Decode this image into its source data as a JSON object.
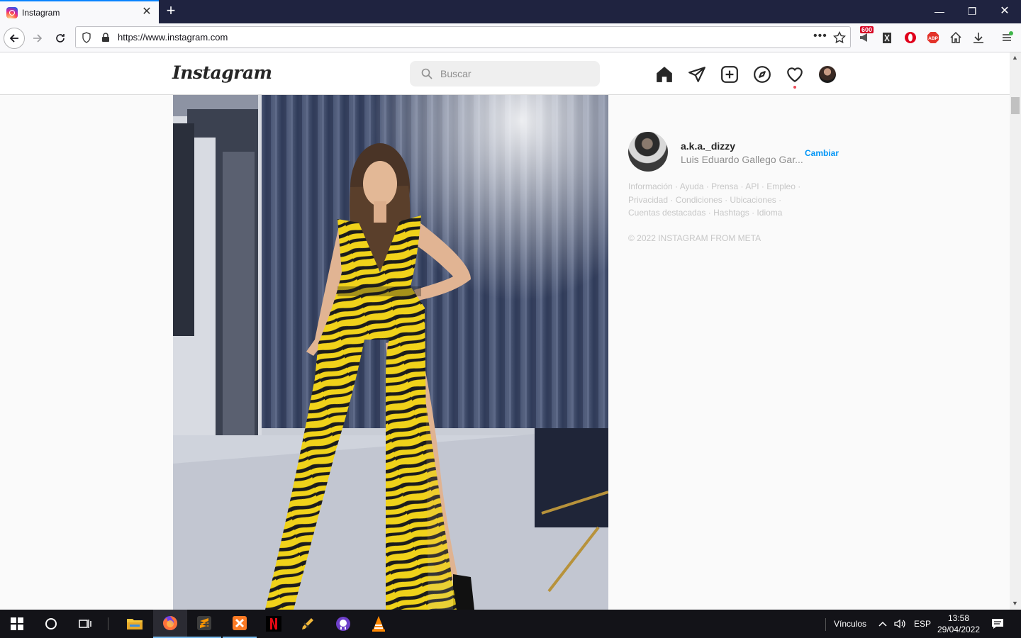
{
  "browser": {
    "tab_title": "Instagram",
    "url": "https://www.instagram.com",
    "badge_count": "600"
  },
  "instagram": {
    "logo": "Instagram",
    "search_placeholder": "Buscar",
    "nav_icons": [
      "home-icon",
      "direct-icon",
      "new-post-icon",
      "explore-icon",
      "activity-icon",
      "profile-avatar"
    ],
    "suggested": {
      "username": "a.k.a._dizzy",
      "fullname": "Luis Eduardo Gallego Gar...",
      "switch_label": "Cambiar"
    },
    "footer_lines": [
      "Información · Ayuda · Prensa · API · Empleo ·",
      "Privacidad · Condiciones · Ubicaciones ·",
      "Cuentas destacadas · Hashtags · Idioma"
    ],
    "copyright": "© 2022 INSTAGRAM FROM META"
  },
  "taskbar": {
    "links_label": "Vínculos",
    "language": "ESP",
    "time": "13:58",
    "date": "29/04/2022"
  },
  "colors": {
    "titlebar": "#1f2340",
    "link_blue": "#0095f6",
    "notification": "#ed4956"
  }
}
